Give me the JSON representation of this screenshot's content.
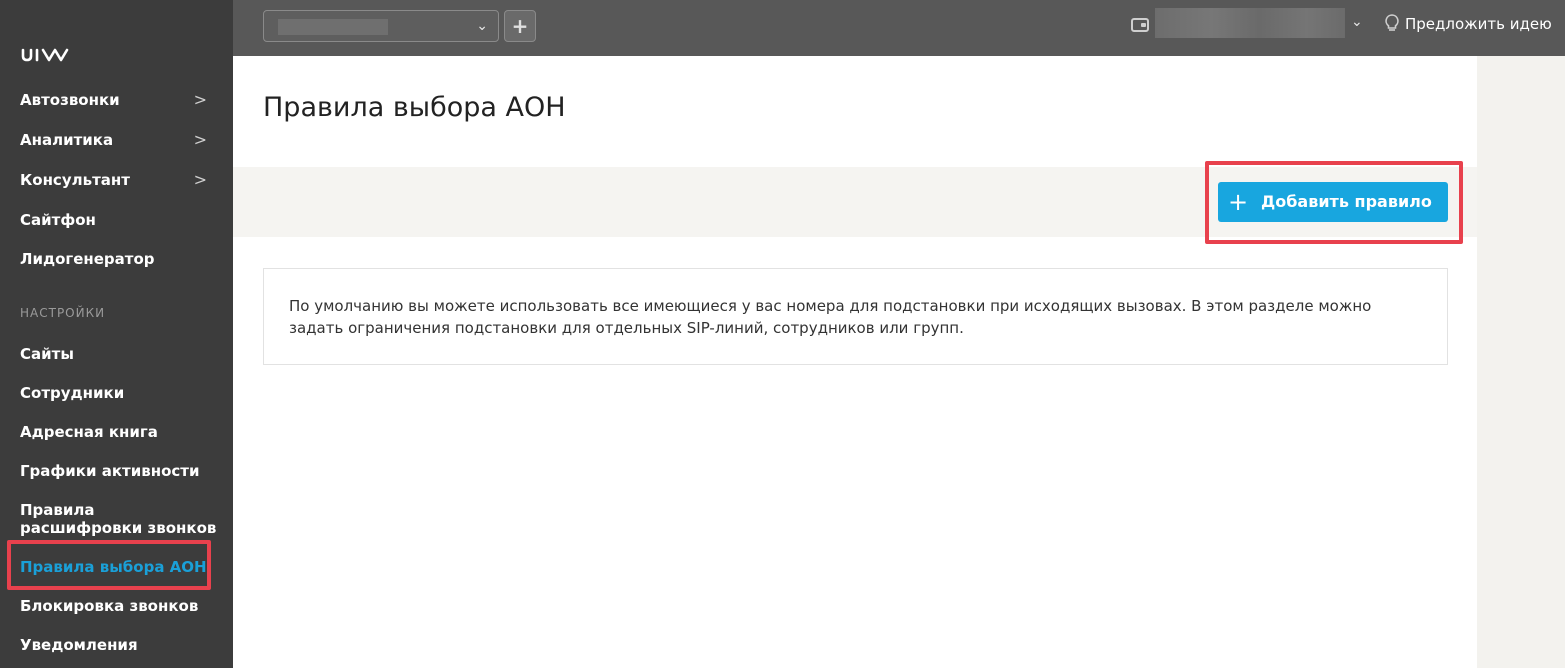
{
  "sidebar": {
    "logo_text": "uis",
    "items": [
      {
        "label": "Автозвонки",
        "chevron": ">"
      },
      {
        "label": "Аналитика",
        "chevron": ">"
      },
      {
        "label": "Консультант",
        "chevron": ">"
      },
      {
        "label": "Сайтфон"
      },
      {
        "label": "Лидогенератор"
      }
    ],
    "section_label": "НАСТРОЙКИ",
    "settings_items": [
      {
        "label": "Сайты"
      },
      {
        "label": "Сотрудники"
      },
      {
        "label": "Адресная книга"
      },
      {
        "label": "Графики активности"
      },
      {
        "label": "Правила расшифровки звонков"
      },
      {
        "label": "Правила выбора АОН",
        "active": true
      },
      {
        "label": "Блокировка звонков"
      },
      {
        "label": "Уведомления"
      }
    ]
  },
  "topbar": {
    "account_caret": "⌄",
    "add_symbol": "+",
    "balance_caret": "⌄",
    "idea_label": "Предложить идею",
    "idea_icon": "lightbulb-icon"
  },
  "main": {
    "title": "Правила выбора АОН",
    "add_button_label": "Добавить правило",
    "info_text": "По умолчанию вы можете использовать все имеющиеся у вас номера для подстановки при исходящих вызовах. В этом разделе можно задать ограничения подстановки для отдельных SIP-линий, сотрудников или групп."
  },
  "colors": {
    "sidebar_bg": "#3c3c3c",
    "topbar_bg": "#585858",
    "accent": "#18a6df",
    "active_link": "#1aa0d8",
    "highlight": "#e8414d"
  }
}
